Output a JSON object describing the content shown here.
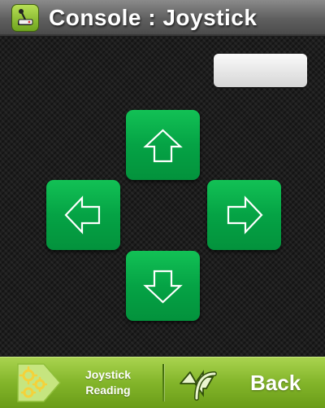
{
  "header": {
    "title": "Console : Joystick",
    "app_icon": "joystick-icon"
  },
  "reading_display": {
    "value": ""
  },
  "dpad": {
    "color": "#0aaa4a",
    "buttons": [
      {
        "direction": "up",
        "icon": "arrow-up-icon"
      },
      {
        "direction": "left",
        "icon": "arrow-left-icon"
      },
      {
        "direction": "right",
        "icon": "arrow-right-icon"
      },
      {
        "direction": "down",
        "icon": "arrow-down-icon"
      }
    ]
  },
  "bottom_bar": {
    "color": "#8dbd33",
    "reading_button": {
      "label_line1": "Joystick",
      "label_line2": "Reading",
      "icon": "gears-icon"
    },
    "back_button": {
      "label": "Back",
      "icon": "back-arrow-icon"
    }
  }
}
